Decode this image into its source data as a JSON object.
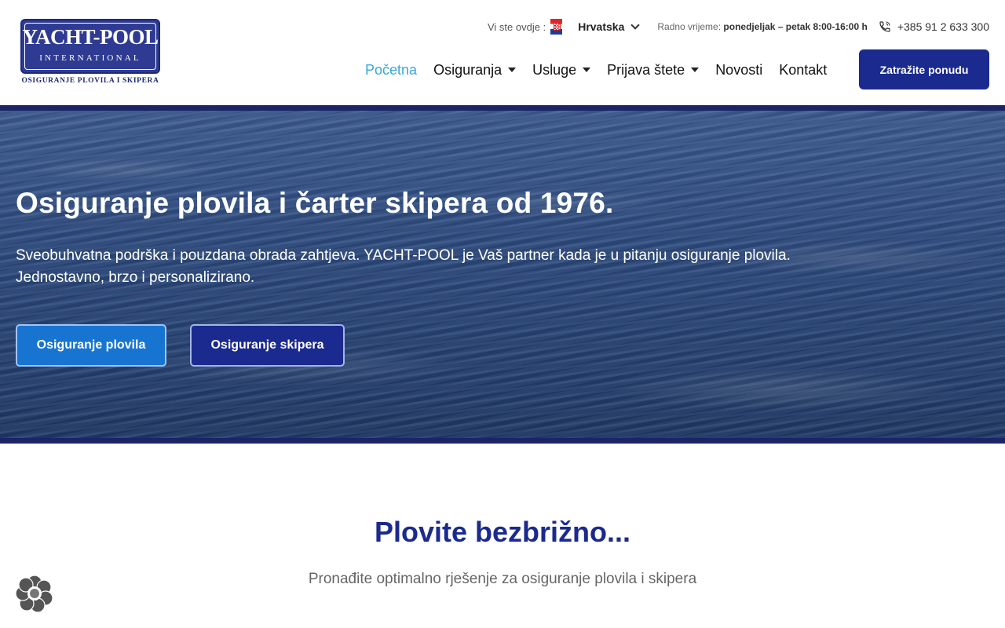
{
  "logo": {
    "line1": "YACHT-POOL",
    "line2": "INTERNATIONAL",
    "line3": "OSIGURANJE PLOVILA I SKIPERA"
  },
  "topbar": {
    "location_label": "Vi ste ovdje :",
    "country": "Hrvatska",
    "hours_label": "Radno vrijeme:",
    "hours_value": "ponedjeljak – petak 8:00-16:00 h",
    "phone": "+385 91 2 633 300",
    "icons": [
      "croatia-flag-icon",
      "chevron-down-icon",
      "phone-icon"
    ]
  },
  "nav": {
    "items": [
      {
        "label": "Početna",
        "active": true,
        "dropdown": false
      },
      {
        "label": "Osiguranja",
        "active": false,
        "dropdown": true
      },
      {
        "label": "Usluge",
        "active": false,
        "dropdown": true
      },
      {
        "label": "Prijava štete",
        "active": false,
        "dropdown": true
      },
      {
        "label": "Novosti",
        "active": false,
        "dropdown": false
      },
      {
        "label": "Kontakt",
        "active": false,
        "dropdown": false
      }
    ],
    "cta_label": "Zatražite ponudu"
  },
  "hero": {
    "title": "Osiguranje plovila i čarter skipera od 1976.",
    "subtitle_line1": "Sveobuhvatna podrška i pouzdana obrada zahtjeva. YACHT-POOL je Vaš partner kada je u pitanju osiguranje plovila.",
    "subtitle_line2": "Jednostavno, brzo i personalizirano.",
    "button_plovila": "Osiguranje plovila",
    "button_skipera": "Osiguranje skipera"
  },
  "section": {
    "title": "Plovite bezbrižno...",
    "subtitle": "Pronađite optimalno rješenje za osiguranje plovila i skipera"
  },
  "colors": {
    "brand_navy": "#1a2a8e",
    "nav_active": "#3aa6d8",
    "button_blue": "#1775d1"
  }
}
